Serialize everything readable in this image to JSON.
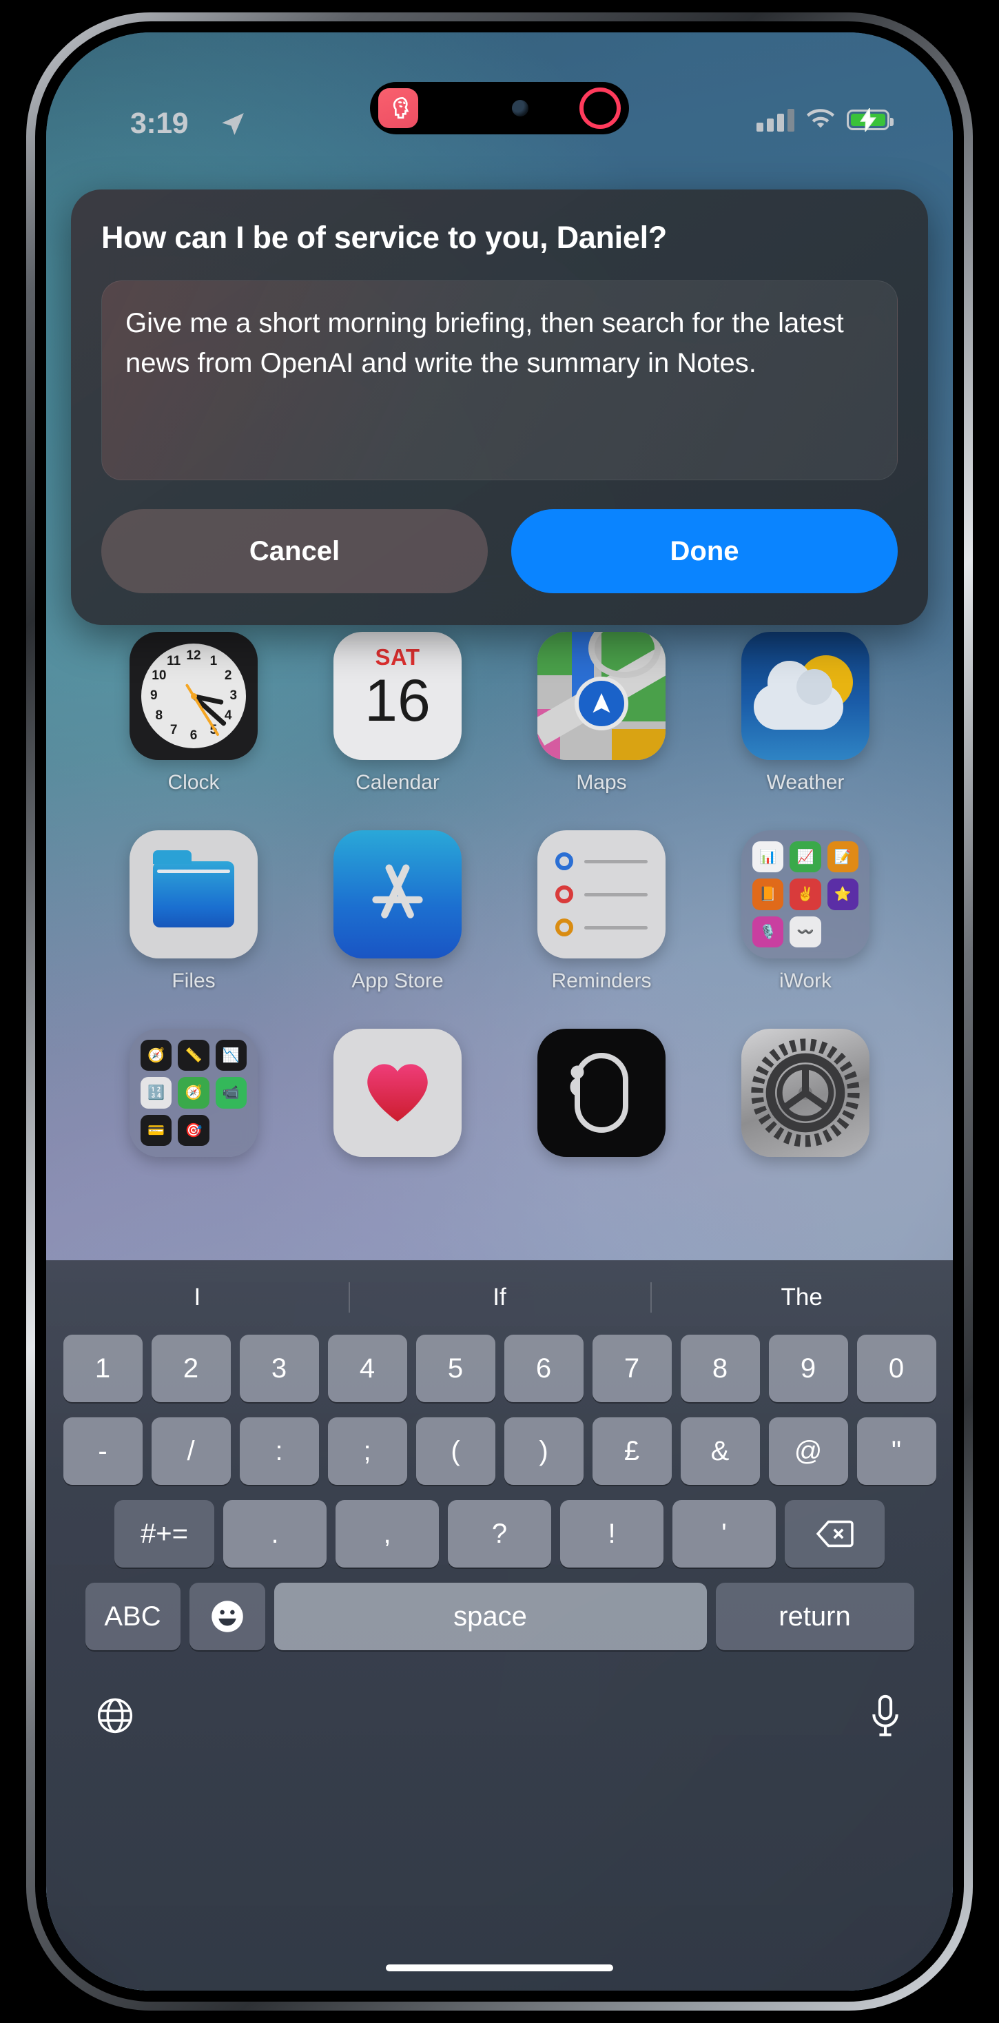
{
  "status_bar": {
    "time": "3:19",
    "location_icon": "location-arrow-icon",
    "signal_icon": "cellular-signal-icon",
    "wifi_icon": "wifi-icon",
    "battery_icon": "battery-charging-icon",
    "battery_color": "#3ac23a"
  },
  "dynamic_island": {
    "app_icon": "brain-head-icon",
    "app_icon_color": "#f4556a",
    "camera_icon": "front-camera-icon",
    "recording_ring_color": "#ff3b5c"
  },
  "dialog": {
    "title": "How can I be of service to you, Daniel?",
    "prompt_value": "Give me a short morning briefing, then search for the latest news from OpenAI and write the summary in Notes.",
    "prompt_placeholder": "",
    "cancel_label": "Cancel",
    "done_label": "Done",
    "done_color": "#0a84ff"
  },
  "home_screen": {
    "apps": [
      {
        "label": "Clock",
        "icon": "clock-app-icon"
      },
      {
        "label": "Calendar",
        "icon": "calendar-app-icon",
        "weekday": "SAT",
        "day": "16"
      },
      {
        "label": "Maps",
        "icon": "maps-app-icon"
      },
      {
        "label": "Weather",
        "icon": "weather-app-icon"
      },
      {
        "label": "Files",
        "icon": "files-app-icon"
      },
      {
        "label": "App Store",
        "icon": "app-store-app-icon"
      },
      {
        "label": "Reminders",
        "icon": "reminders-app-icon"
      },
      {
        "label": "iWork",
        "icon": "iwork-folder-icon"
      },
      {
        "label": "",
        "icon": "utilities-folder-icon"
      },
      {
        "label": "",
        "icon": "health-app-icon"
      },
      {
        "label": "",
        "icon": "watch-app-icon"
      },
      {
        "label": "",
        "icon": "settings-app-icon"
      }
    ]
  },
  "keyboard": {
    "suggestions": [
      "I",
      "If",
      "The"
    ],
    "row_numbers": [
      "1",
      "2",
      "3",
      "4",
      "5",
      "6",
      "7",
      "8",
      "9",
      "0"
    ],
    "row_symbols": [
      "-",
      "/",
      ":",
      ";",
      "(",
      ")",
      "£",
      "&",
      "@",
      "\""
    ],
    "row_punct": [
      ".",
      ",",
      "?",
      "!",
      "'"
    ],
    "symbols_toggle_label": "#+=",
    "backspace_icon": "backspace-icon",
    "abc_label": "ABC",
    "emoji_icon": "emoji-smiley-icon",
    "space_label": "space",
    "return_label": "return",
    "globe_icon": "globe-icon",
    "mic_icon": "microphone-icon"
  }
}
